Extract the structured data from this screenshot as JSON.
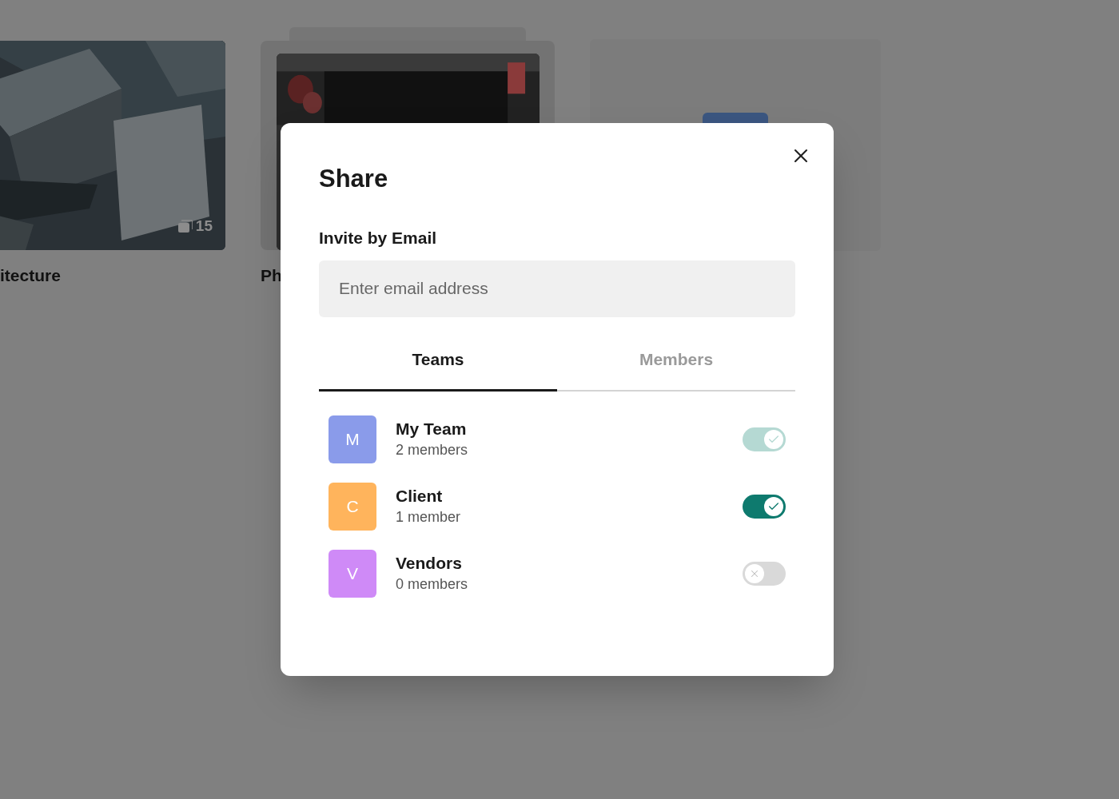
{
  "albums": [
    {
      "title": "itecture",
      "count": "15"
    },
    {
      "kind": "stack",
      "title": "Ph"
    },
    {
      "kind": "empty"
    }
  ],
  "dialog": {
    "title": "Share",
    "invite_label": "Invite by Email",
    "email": {
      "placeholder": "Enter email address"
    },
    "tabs": [
      {
        "label": "Teams",
        "selected": true
      },
      {
        "label": "Members",
        "selected": false
      }
    ],
    "teams": [
      {
        "initial": "M",
        "name": "My Team",
        "members": "2 members",
        "color": "#8a9bea",
        "on": true,
        "disabled": true
      },
      {
        "initial": "C",
        "name": "Client",
        "members": "1 member",
        "color": "#ffb45c",
        "on": true,
        "disabled": false
      },
      {
        "initial": "V",
        "name": "Vendors",
        "members": "0 members",
        "color": "#cf8af7",
        "on": false,
        "disabled": false
      }
    ]
  }
}
